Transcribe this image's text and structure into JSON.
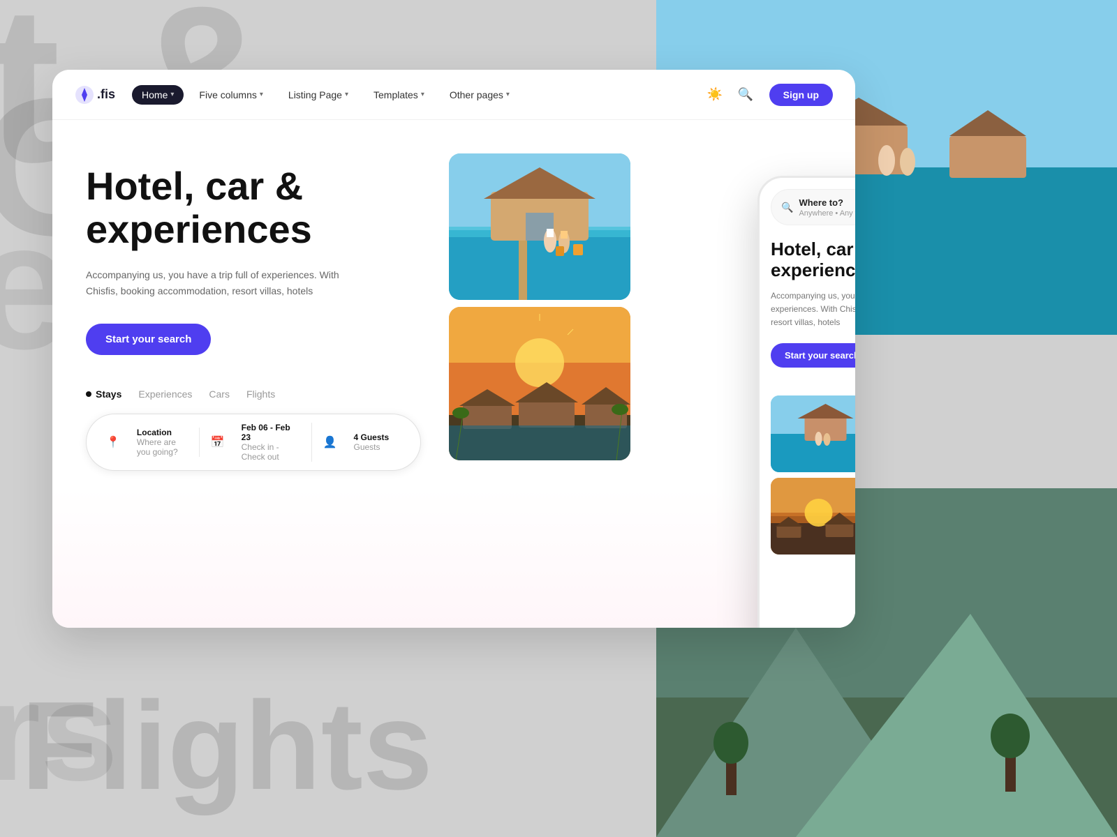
{
  "background": {
    "text1": "t &",
    "text2": "C",
    "text3": "eso",
    "text4": "rs",
    "text5": "Flights"
  },
  "navbar": {
    "logo_symbol": "◈",
    "logo_name": ".fis",
    "nav_items": [
      {
        "label": "Home",
        "active": true,
        "has_chevron": true
      },
      {
        "label": "Five columns",
        "active": false,
        "has_chevron": true
      },
      {
        "label": "Listing Page",
        "active": false,
        "has_chevron": true
      },
      {
        "label": "Templates",
        "active": false,
        "has_chevron": true
      },
      {
        "label": "Other pages",
        "active": false,
        "has_chevron": true
      }
    ],
    "theme_icon": "☀",
    "search_icon": "🔍",
    "signup_label": "Sign up"
  },
  "hero": {
    "title_line1": "Hotel, car &",
    "title_line2": "experiences",
    "subtitle": "Accompanying us, you have a trip full of experiences. With Chisfis, booking accommodation, resort villas, hotels",
    "cta_label": "Start your search",
    "tabs": [
      {
        "label": "Stays",
        "active": true
      },
      {
        "label": "Experiences",
        "active": false
      },
      {
        "label": "Cars",
        "active": false
      },
      {
        "label": "Flights",
        "active": false
      }
    ],
    "search_bar": {
      "location_label": "Location",
      "location_placeholder": "Where are you going?",
      "date_label": "Feb 06 - Feb 23",
      "date_sub": "Check in - Check out",
      "guests_label": "4 Guests",
      "guests_sub": "Guests"
    }
  },
  "mobile": {
    "search_label": "Where to?",
    "search_sub": "Anywhere • Any week • Add guests",
    "title_line1": "Hotel, car &",
    "title_line2": "experiences",
    "subtitle": "Accompanying us, you have a trip full of experiences. With Chisfis, booking accommodation, resort villas, hotels",
    "cta_label": "Start your search"
  },
  "colors": {
    "primary": "#4f3ef0",
    "dark": "#1a1a2e",
    "text_secondary": "#666"
  }
}
